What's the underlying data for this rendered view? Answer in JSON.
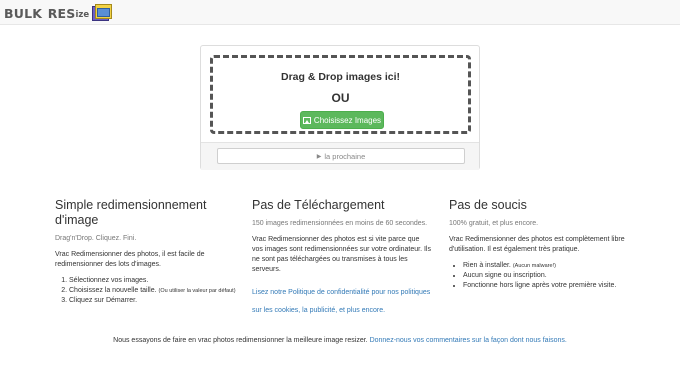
{
  "header": {
    "logo_big1": "BULK",
    "logo_big2": "RES",
    "logo_small": "ize"
  },
  "upload": {
    "drop_text": "Drag & Drop images ici!",
    "or_text": "OU",
    "choose_label": "Choisissez Images",
    "next_label": "la prochaine"
  },
  "features": {
    "col1": {
      "title": "Simple redimensionnement d'image",
      "lead": "Drag'n'Drop. Cliquez. Fini.",
      "desc": "Vrac Redimensionner des photos, il est facile de redimensionner des lots d'images.",
      "steps": [
        {
          "text": "Sélectionnez vos images.",
          "note": ""
        },
        {
          "text": "Choisissez la nouvelle taille.",
          "note": "(Ou utiliser la valeur par défaut)"
        },
        {
          "text": "Cliquez sur Démarrer.",
          "note": ""
        }
      ]
    },
    "col2": {
      "title": "Pas de Téléchargement",
      "lead": "150 images redimensionnées en moins de 60 secondes.",
      "desc": "Vrac Redimensionner des photos est si vite parce que vos images sont redimensionnées sur votre ordinateur. Ils ne sont pas téléchargées ou transmises à tous les serveurs.",
      "link": "Lisez notre Politique de confidentialité pour nos politiques sur les cookies, la publicité, et plus encore."
    },
    "col3": {
      "title": "Pas de soucis",
      "lead": "100% gratuit, et plus encore.",
      "desc": "Vrac Redimensionner des photos est complètement libre d'utilisation. Il est également très pratique.",
      "bullets": [
        {
          "text": "Rien à installer.",
          "note": "(Aucun malware!)"
        },
        {
          "text": "Aucun signe ou inscription.",
          "note": ""
        },
        {
          "text": "Fonctionne hors ligne après votre première visite.",
          "note": ""
        }
      ]
    }
  },
  "footer": {
    "text": "Nous essayons de faire en vrac photos redimensionner la meilleure image resizer.",
    "link": "Donnez-nous vos commentaires sur la façon dont nous faisons."
  }
}
